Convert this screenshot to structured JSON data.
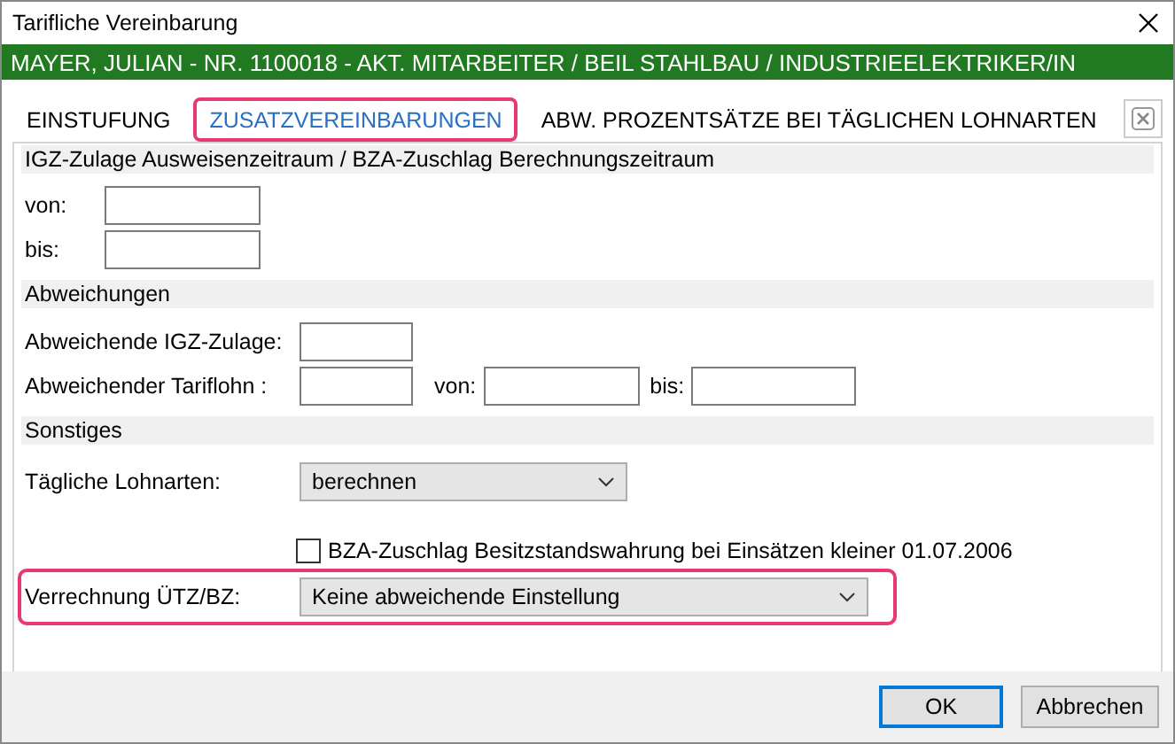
{
  "window": {
    "title": "Tarifliche Vereinbarung"
  },
  "header_bar": {
    "text": "MAYER, JULIAN - NR. 1100018 - AKT. MITARBEITER / BEIL STAHLBAU / INDUSTRIEELEKTRIKER/IN"
  },
  "tabs": [
    {
      "label": "EINSTUFUNG",
      "selected": false,
      "highlighted": false
    },
    {
      "label": "ZUSATZVEREINBARUNGEN",
      "selected": true,
      "highlighted": true
    },
    {
      "label": "ABW. PROZENTSÄTZE BEI TÄGLICHEN LOHNARTEN",
      "selected": false,
      "highlighted": false
    }
  ],
  "sections": [
    {
      "title": "IGZ-Zulage Ausweisenzeitraum / BZA-Zuschlag Berechnungszeitraum",
      "rows": [
        {
          "kind": "date",
          "label": "von:"
        },
        {
          "kind": "date",
          "label": "bis:"
        }
      ]
    },
    {
      "title": "Abweichungen",
      "rows": [
        {
          "kind": "amount",
          "label": "Abweichende IGZ-Zulage:"
        },
        {
          "kind": "amount",
          "label": "Abweichender Tariflohn :",
          "extra_fields": [
            "von:",
            "bis:"
          ]
        }
      ]
    },
    {
      "title": "Sonstiges",
      "rows": [
        {
          "kind": "select",
          "label": "Tägliche Lohnarten:",
          "value": "berechnen",
          "highlighted": false,
          "wide": false
        },
        {
          "kind": "checkbox",
          "label": "BZA-Zuschlag Besitzstandswahrung bei Einsätzen kleiner 01.07.2006",
          "checked": false
        },
        {
          "kind": "select",
          "label": "Verrechnung ÜTZ/BZ:",
          "value": "Keine abweichende Einstellung",
          "highlighted": true,
          "wide": true
        }
      ]
    }
  ],
  "buttons": [
    {
      "label": "OK",
      "default": true
    },
    {
      "label": "Abbrechen",
      "default": false
    }
  ]
}
